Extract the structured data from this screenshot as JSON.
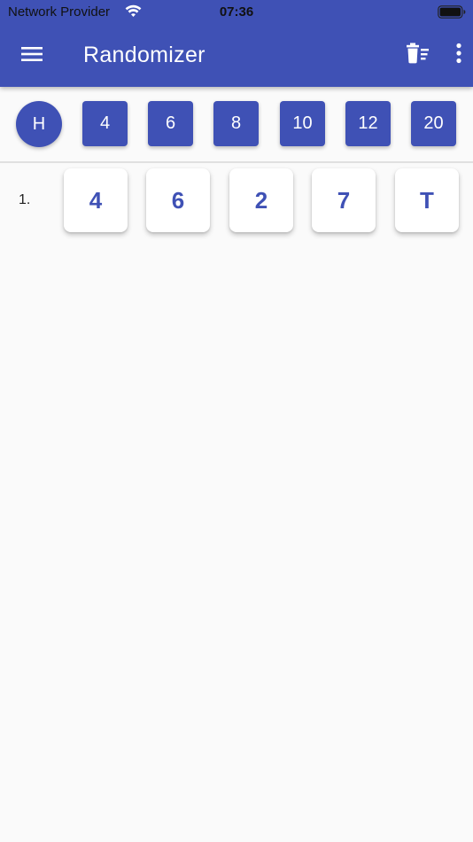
{
  "status_bar": {
    "carrier": "Network Provider",
    "time": "07:36",
    "icons": [
      "wifi-icon",
      "battery-icon"
    ]
  },
  "app_bar": {
    "title": "Randomizer",
    "icons": [
      "menu-icon",
      "clear-all-icon",
      "more-vert-icon"
    ],
    "background_color": "#3f51b5"
  },
  "dice": [
    {
      "label": "H",
      "kind": "coin"
    },
    {
      "label": "4",
      "kind": "die"
    },
    {
      "label": "6",
      "kind": "die"
    },
    {
      "label": "8",
      "kind": "die"
    },
    {
      "label": "10",
      "kind": "die"
    },
    {
      "label": "12",
      "kind": "die"
    },
    {
      "label": "20",
      "kind": "die"
    }
  ],
  "results": [
    {
      "index": "1.",
      "values": [
        "4",
        "6",
        "2",
        "7",
        "T"
      ]
    }
  ],
  "colors": {
    "accent": "#3f51b5",
    "background": "#fafafa",
    "card": "#ffffff"
  }
}
